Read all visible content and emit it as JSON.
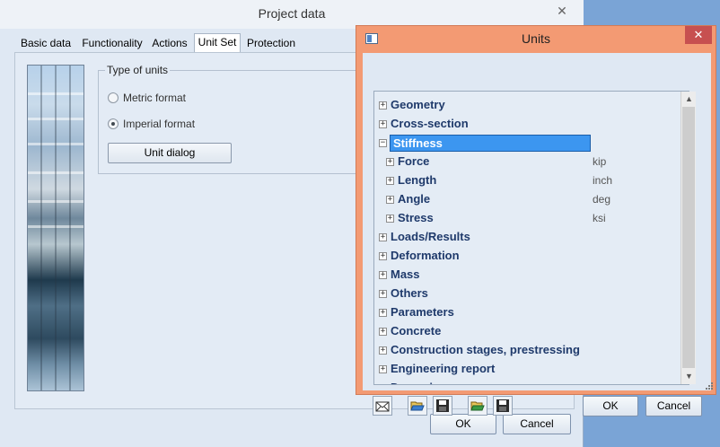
{
  "project_window": {
    "title": "Project data",
    "close_glyph": "✕",
    "tabs": [
      {
        "label": "Basic data",
        "active": false
      },
      {
        "label": "Functionality",
        "active": false
      },
      {
        "label": "Actions",
        "active": false
      },
      {
        "label": "Unit Set",
        "active": true
      },
      {
        "label": "Protection",
        "active": false
      }
    ],
    "units_group": {
      "label": "Type of units",
      "options": [
        {
          "label": "Metric format",
          "checked": false
        },
        {
          "label": "Imperial format",
          "checked": true
        }
      ],
      "unit_dialog_label": "Unit dialog"
    },
    "ok_label": "OK",
    "cancel_label": "Cancel"
  },
  "units_window": {
    "title": "Units",
    "close_glyph": "✕",
    "sys_icon": "window-icon",
    "tree": [
      {
        "label": "Geometry",
        "level": 0,
        "expander": "+",
        "selected": false,
        "unit": ""
      },
      {
        "label": "Cross-section",
        "level": 0,
        "expander": "+",
        "selected": false,
        "unit": ""
      },
      {
        "label": "Stiffness",
        "level": 0,
        "expander": "−",
        "selected": true,
        "unit": ""
      },
      {
        "label": "Force",
        "level": 1,
        "expander": "+",
        "selected": false,
        "unit": "kip"
      },
      {
        "label": "Length",
        "level": 1,
        "expander": "+",
        "selected": false,
        "unit": "inch"
      },
      {
        "label": "Angle",
        "level": 1,
        "expander": "+",
        "selected": false,
        "unit": "deg"
      },
      {
        "label": "Stress",
        "level": 1,
        "expander": "+",
        "selected": false,
        "unit": "ksi"
      },
      {
        "label": "Loads/Results",
        "level": 0,
        "expander": "+",
        "selected": false,
        "unit": ""
      },
      {
        "label": "Deformation",
        "level": 0,
        "expander": "+",
        "selected": false,
        "unit": ""
      },
      {
        "label": "Mass",
        "level": 0,
        "expander": "+",
        "selected": false,
        "unit": ""
      },
      {
        "label": "Others",
        "level": 0,
        "expander": "+",
        "selected": false,
        "unit": ""
      },
      {
        "label": "Parameters",
        "level": 0,
        "expander": "+",
        "selected": false,
        "unit": ""
      },
      {
        "label": "Concrete",
        "level": 0,
        "expander": "+",
        "selected": false,
        "unit": ""
      },
      {
        "label": "Construction stages, prestressing",
        "level": 0,
        "expander": "+",
        "selected": false,
        "unit": ""
      },
      {
        "label": "Engineering report",
        "level": 0,
        "expander": "+",
        "selected": false,
        "unit": ""
      },
      {
        "label": "Dynamics",
        "level": 0,
        "expander": "+",
        "selected": false,
        "unit": ""
      }
    ],
    "toolbar": [
      {
        "name": "envelope-icon"
      },
      {
        "name": "open-folder-icon"
      },
      {
        "name": "save-icon"
      },
      {
        "name": "open-folder-green-icon"
      },
      {
        "name": "save-icon-2"
      }
    ],
    "scroll_up_glyph": "▲",
    "scroll_down_glyph": "▼",
    "ok_label": "OK",
    "cancel_label": "Cancel"
  },
  "colors": {
    "dialog_frame": "#f39a73",
    "selection": "#3c96f0",
    "tree_text": "#1f3a6b"
  }
}
